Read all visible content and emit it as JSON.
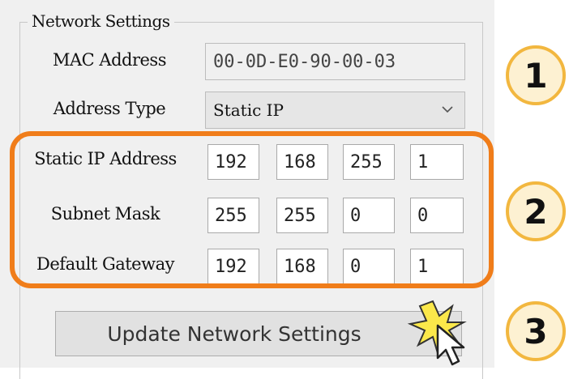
{
  "group": {
    "title": "Network Settings"
  },
  "mac": {
    "label": "MAC Address",
    "value": "00-0D-E0-90-00-03"
  },
  "address_type": {
    "label": "Address Type",
    "selected": "Static IP"
  },
  "static_ip": {
    "label": "Static IP Address",
    "octets": [
      "192",
      "168",
      "255",
      "1"
    ]
  },
  "subnet": {
    "label": "Subnet Mask",
    "octets": [
      "255",
      "255",
      "0",
      "0"
    ]
  },
  "gateway": {
    "label": "Default Gateway",
    "octets": [
      "192",
      "168",
      "0",
      "1"
    ]
  },
  "update_button": {
    "label": "Update Network Settings"
  },
  "steps": [
    "1",
    "2",
    "3"
  ],
  "colors": {
    "highlight": "#f07d1a",
    "badge_border": "#f2b73f",
    "badge_fill": "#fdf1d2",
    "click_star": "#fbe84a"
  },
  "icons": {
    "dropdown": "chevron-down-icon",
    "cursor": "mouse-pointer-icon",
    "click": "click-burst-icon"
  }
}
